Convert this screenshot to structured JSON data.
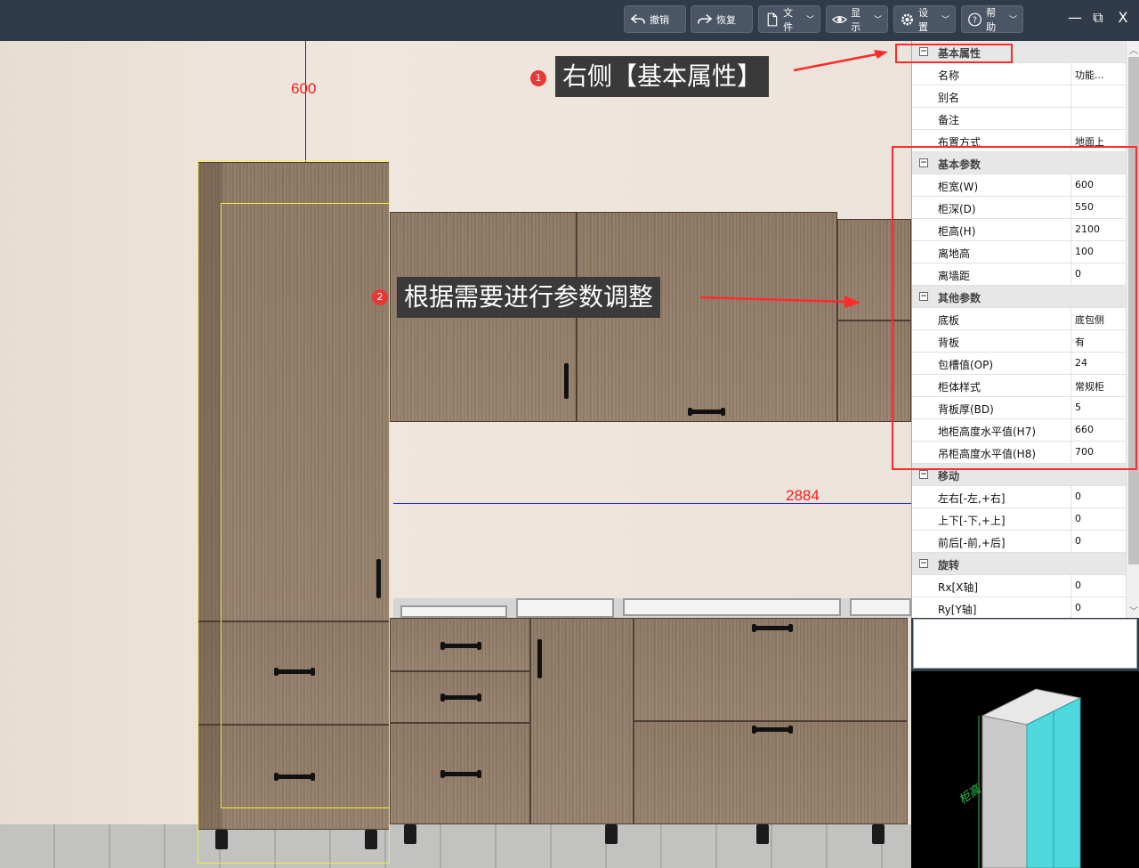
{
  "toolbar": {
    "undo": "撤销",
    "redo": "恢复",
    "file": "文件",
    "display": "显示",
    "settings": "设置",
    "help": "帮助"
  },
  "window": {
    "minimize": "—",
    "restore": "⧉",
    "close": "X"
  },
  "viewport": {
    "dim_height_label": "600",
    "dim_width_label": "2884"
  },
  "callouts": [
    {
      "badge": "1",
      "text": "右侧【基本属性】"
    },
    {
      "badge": "2",
      "text": "根据需要进行参数调整"
    }
  ],
  "properties": {
    "basic": {
      "group": "基本属性",
      "rows": [
        {
          "k": "名称",
          "v": "功能..."
        },
        {
          "k": "别名",
          "v": ""
        },
        {
          "k": "备注",
          "v": ""
        },
        {
          "k": "布置方式",
          "v": "地面上"
        }
      ]
    },
    "params": {
      "group": "基本参数",
      "rows": [
        {
          "k": "柜宽(W)",
          "v": "600"
        },
        {
          "k": "柜深(D)",
          "v": "550"
        },
        {
          "k": "柜高(H)",
          "v": "2100"
        },
        {
          "k": "离地高",
          "v": "100"
        },
        {
          "k": "离墙距",
          "v": "0"
        }
      ]
    },
    "other": {
      "group": "其他参数",
      "rows": [
        {
          "k": "底板",
          "v": "底包侧"
        },
        {
          "k": "背板",
          "v": "有"
        },
        {
          "k": "包槽值(OP)",
          "v": "24"
        },
        {
          "k": "柜体样式",
          "v": "常规柜"
        },
        {
          "k": "背板厚(BD)",
          "v": "5"
        },
        {
          "k": "地柜高度水平值(H7)",
          "v": "660"
        },
        {
          "k": "吊柜高度水平值(H8)",
          "v": "700"
        }
      ]
    },
    "move": {
      "group": "移动",
      "rows": [
        {
          "k": "左右[-左,+右]",
          "v": "0"
        },
        {
          "k": "上下[-下,+上]",
          "v": "0"
        },
        {
          "k": "前后[-前,+后]",
          "v": "0"
        }
      ]
    },
    "rotate": {
      "group": "旋转",
      "rows": [
        {
          "k": "Rx[X轴]",
          "v": "0"
        },
        {
          "k": "Ry[Y轴]",
          "v": "0"
        }
      ]
    }
  },
  "preview": {
    "label": "柜高"
  },
  "colors": {
    "toolbar_bg": "#2f3b49",
    "highlight": "#ff2a2a",
    "preview_cabinet": "#4dd9dd",
    "dimension_line": "#1a1aff"
  }
}
